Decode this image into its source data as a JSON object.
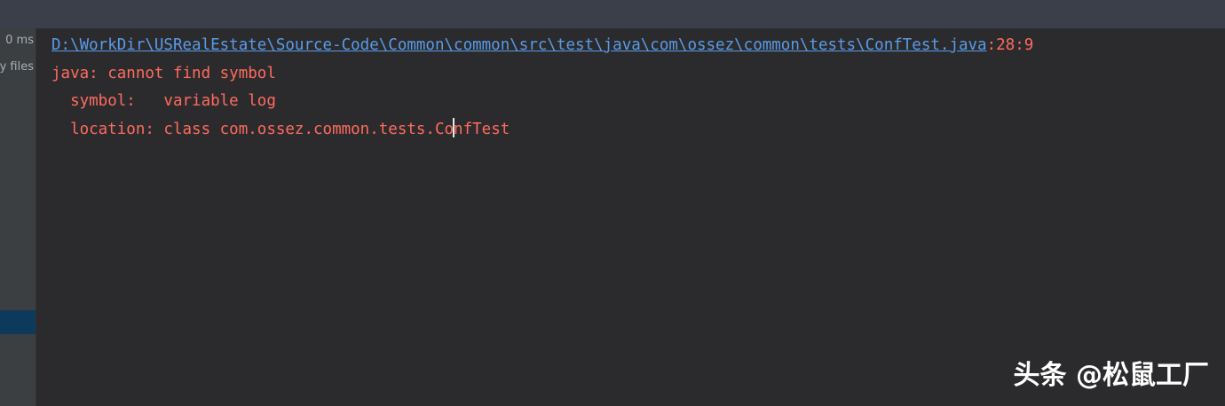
{
  "sidebar": {
    "time_text": "0 ms",
    "files_text": "y files"
  },
  "console": {
    "path_link": "D:\\WorkDir\\USRealEstate\\Source-Code\\Common\\common\\src\\test\\java\\com\\ossez\\common\\tests\\ConfTest.java",
    "path_position": ":28:9",
    "error_line": "java: cannot find symbol",
    "symbol_line": "  symbol:   variable log",
    "location_before_caret": "  location: class com.ossez.common.tests.Co",
    "location_after_caret": "nfTest"
  },
  "watermark": {
    "text": "头条 @松鼠工厂"
  },
  "colors": {
    "error_text": "#ff6b5e",
    "link": "#5a9be8",
    "background": "#2b2b2d"
  }
}
